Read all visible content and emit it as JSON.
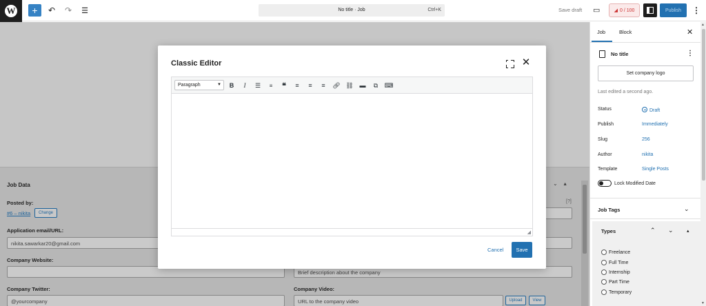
{
  "topbar": {
    "add_icon": "plus-icon",
    "undo_icon": "undo-icon",
    "redo_icon": "redo-icon",
    "outline_icon": "list-view-icon",
    "document_title": "No title · Job",
    "shortcut": "Ctrl+K",
    "save_draft": "Save draft",
    "seo_score": "0 / 100",
    "publish": "Publish"
  },
  "modal": {
    "title": "Classic Editor",
    "format_value": "Paragraph",
    "tools": [
      "bold-icon",
      "italic-icon",
      "bullet-list-icon",
      "numbered-list-icon",
      "blockquote-icon",
      "align-left-icon",
      "align-center-icon",
      "align-right-icon",
      "link-icon",
      "unlink-icon",
      "read-more-icon",
      "toolbar-toggle-icon",
      "keyboard-icon"
    ],
    "cancel": "Cancel",
    "save": "Save"
  },
  "jobdata": {
    "header": "Job Data",
    "help": "[?]",
    "posted_by_label": "Posted by:",
    "posted_by_value": "#6 – nikita",
    "change_btn": "Change",
    "app_email_label": "Application email/URL:",
    "app_email_value": "nikita.sawarkar20@gmail.com",
    "company_website_label": "Company Website:",
    "tagline_placeholder": "Brief description about the company",
    "company_twitter_label": "Company Twitter:",
    "company_twitter_placeholder": "@yourcompany",
    "company_video_label": "Company Video:",
    "company_video_placeholder": "URL to the company video",
    "upload_btn": "Upload",
    "view_btn": "View"
  },
  "sidebar": {
    "tab_job": "Job",
    "tab_block": "Block",
    "doc_title": "No title",
    "set_logo": "Set company logo",
    "last_edited": "Last edited a second ago.",
    "rows": [
      {
        "label": "Status",
        "value": "Draft"
      },
      {
        "label": "Publish",
        "value": "Immediately"
      },
      {
        "label": "Slug",
        "value": "256"
      },
      {
        "label": "Author",
        "value": "nikita"
      },
      {
        "label": "Template",
        "value": "Single Posts"
      }
    ],
    "lock_modified": "Lock Modified Date",
    "job_tags": "Job Tags",
    "types_title": "Types",
    "types": [
      "Freelance",
      "Full Time",
      "Internship",
      "Part Time",
      "Temporary"
    ]
  }
}
